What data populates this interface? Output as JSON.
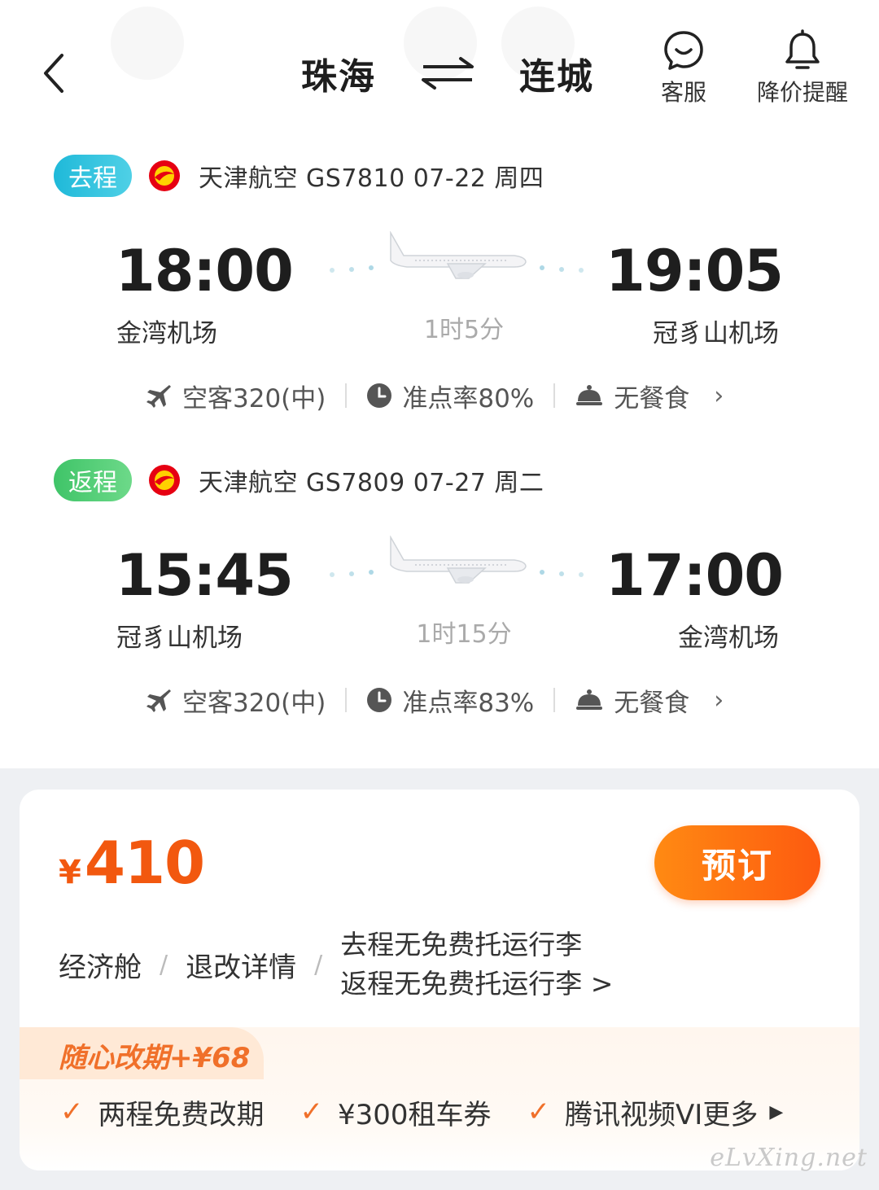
{
  "header": {
    "origin": "珠海",
    "destination": "连城",
    "service_label": "客服",
    "price_alert_label": "降价提醒"
  },
  "outbound": {
    "badge": "去程",
    "flight_info": "天津航空 GS7810  07-22 周四",
    "dep_time": "18:00",
    "arr_time": "19:05",
    "dep_airport": "金湾机场",
    "arr_airport": "冠豸山机场",
    "duration": "1时5分",
    "aircraft": "空客320(中)",
    "ontime": "准点率80%",
    "meal": "无餐食",
    "badge_color": "#1fb9d9"
  },
  "return": {
    "badge": "返程",
    "flight_info": "天津航空 GS7809  07-27 周二",
    "dep_time": "15:45",
    "arr_time": "17:00",
    "dep_airport": "冠豸山机场",
    "arr_airport": "金湾机场",
    "duration": "1时15分",
    "aircraft": "空客320(中)",
    "ontime": "准点率83%",
    "meal": "无餐食",
    "badge_color": "#3fc468"
  },
  "offer": {
    "currency": "¥",
    "price": "410",
    "book_label": "预订",
    "cabin": "经济舱",
    "refund_label": "退改详情",
    "baggage_out": "去程无免费托运行李",
    "baggage_ret": "返程无免费托运行李 >",
    "addon_title": "随心改期+¥68",
    "perks": [
      "两程免费改期",
      "¥300租车券",
      "腾讯视频VI"
    ],
    "more_label": "更多",
    "accent_color": "#f2580f"
  },
  "watermark": "eLvXing.net"
}
